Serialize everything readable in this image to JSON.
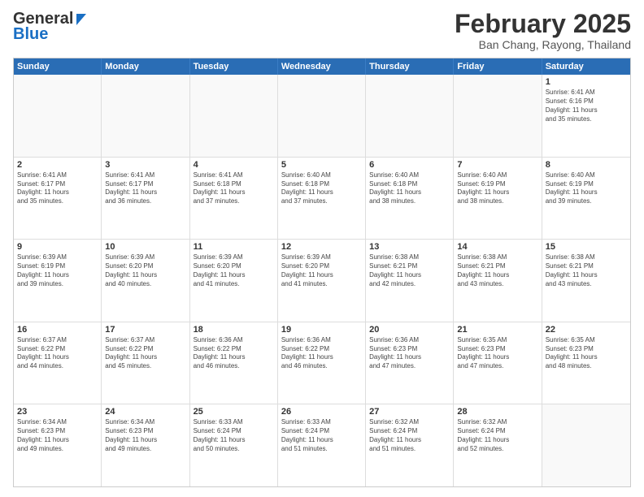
{
  "header": {
    "logo_general": "General",
    "logo_blue": "Blue",
    "title": "February 2025",
    "subtitle": "Ban Chang, Rayong, Thailand"
  },
  "calendar": {
    "days_of_week": [
      "Sunday",
      "Monday",
      "Tuesday",
      "Wednesday",
      "Thursday",
      "Friday",
      "Saturday"
    ],
    "weeks": [
      [
        {
          "day": "",
          "info": ""
        },
        {
          "day": "",
          "info": ""
        },
        {
          "day": "",
          "info": ""
        },
        {
          "day": "",
          "info": ""
        },
        {
          "day": "",
          "info": ""
        },
        {
          "day": "",
          "info": ""
        },
        {
          "day": "1",
          "info": "Sunrise: 6:41 AM\nSunset: 6:16 PM\nDaylight: 11 hours\nand 35 minutes."
        }
      ],
      [
        {
          "day": "2",
          "info": "Sunrise: 6:41 AM\nSunset: 6:17 PM\nDaylight: 11 hours\nand 35 minutes."
        },
        {
          "day": "3",
          "info": "Sunrise: 6:41 AM\nSunset: 6:17 PM\nDaylight: 11 hours\nand 36 minutes."
        },
        {
          "day": "4",
          "info": "Sunrise: 6:41 AM\nSunset: 6:18 PM\nDaylight: 11 hours\nand 37 minutes."
        },
        {
          "day": "5",
          "info": "Sunrise: 6:40 AM\nSunset: 6:18 PM\nDaylight: 11 hours\nand 37 minutes."
        },
        {
          "day": "6",
          "info": "Sunrise: 6:40 AM\nSunset: 6:18 PM\nDaylight: 11 hours\nand 38 minutes."
        },
        {
          "day": "7",
          "info": "Sunrise: 6:40 AM\nSunset: 6:19 PM\nDaylight: 11 hours\nand 38 minutes."
        },
        {
          "day": "8",
          "info": "Sunrise: 6:40 AM\nSunset: 6:19 PM\nDaylight: 11 hours\nand 39 minutes."
        }
      ],
      [
        {
          "day": "9",
          "info": "Sunrise: 6:39 AM\nSunset: 6:19 PM\nDaylight: 11 hours\nand 39 minutes."
        },
        {
          "day": "10",
          "info": "Sunrise: 6:39 AM\nSunset: 6:20 PM\nDaylight: 11 hours\nand 40 minutes."
        },
        {
          "day": "11",
          "info": "Sunrise: 6:39 AM\nSunset: 6:20 PM\nDaylight: 11 hours\nand 41 minutes."
        },
        {
          "day": "12",
          "info": "Sunrise: 6:39 AM\nSunset: 6:20 PM\nDaylight: 11 hours\nand 41 minutes."
        },
        {
          "day": "13",
          "info": "Sunrise: 6:38 AM\nSunset: 6:21 PM\nDaylight: 11 hours\nand 42 minutes."
        },
        {
          "day": "14",
          "info": "Sunrise: 6:38 AM\nSunset: 6:21 PM\nDaylight: 11 hours\nand 43 minutes."
        },
        {
          "day": "15",
          "info": "Sunrise: 6:38 AM\nSunset: 6:21 PM\nDaylight: 11 hours\nand 43 minutes."
        }
      ],
      [
        {
          "day": "16",
          "info": "Sunrise: 6:37 AM\nSunset: 6:22 PM\nDaylight: 11 hours\nand 44 minutes."
        },
        {
          "day": "17",
          "info": "Sunrise: 6:37 AM\nSunset: 6:22 PM\nDaylight: 11 hours\nand 45 minutes."
        },
        {
          "day": "18",
          "info": "Sunrise: 6:36 AM\nSunset: 6:22 PM\nDaylight: 11 hours\nand 46 minutes."
        },
        {
          "day": "19",
          "info": "Sunrise: 6:36 AM\nSunset: 6:22 PM\nDaylight: 11 hours\nand 46 minutes."
        },
        {
          "day": "20",
          "info": "Sunrise: 6:36 AM\nSunset: 6:23 PM\nDaylight: 11 hours\nand 47 minutes."
        },
        {
          "day": "21",
          "info": "Sunrise: 6:35 AM\nSunset: 6:23 PM\nDaylight: 11 hours\nand 47 minutes."
        },
        {
          "day": "22",
          "info": "Sunrise: 6:35 AM\nSunset: 6:23 PM\nDaylight: 11 hours\nand 48 minutes."
        }
      ],
      [
        {
          "day": "23",
          "info": "Sunrise: 6:34 AM\nSunset: 6:23 PM\nDaylight: 11 hours\nand 49 minutes."
        },
        {
          "day": "24",
          "info": "Sunrise: 6:34 AM\nSunset: 6:23 PM\nDaylight: 11 hours\nand 49 minutes."
        },
        {
          "day": "25",
          "info": "Sunrise: 6:33 AM\nSunset: 6:24 PM\nDaylight: 11 hours\nand 50 minutes."
        },
        {
          "day": "26",
          "info": "Sunrise: 6:33 AM\nSunset: 6:24 PM\nDaylight: 11 hours\nand 51 minutes."
        },
        {
          "day": "27",
          "info": "Sunrise: 6:32 AM\nSunset: 6:24 PM\nDaylight: 11 hours\nand 51 minutes."
        },
        {
          "day": "28",
          "info": "Sunrise: 6:32 AM\nSunset: 6:24 PM\nDaylight: 11 hours\nand 52 minutes."
        },
        {
          "day": "",
          "info": ""
        }
      ]
    ]
  }
}
